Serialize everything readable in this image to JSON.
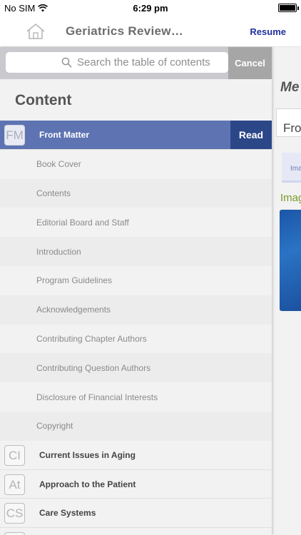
{
  "status_bar": {
    "carrier": "No SIM",
    "time": "6:29 pm"
  },
  "nav": {
    "title": "Geriatrics Review…",
    "resume_label": "Resume"
  },
  "search": {
    "placeholder": "Search the table of contents",
    "value": "",
    "cancel_label": "Cancel"
  },
  "toc": {
    "heading": "Content",
    "front_matter": {
      "badge": "FM",
      "title": "Front Matter",
      "read_label": "Read"
    },
    "front_items": [
      "Book Cover",
      "Contents",
      "Editorial Board and Staff",
      "Introduction",
      "Program Guidelines",
      "Acknowledgements",
      "Contributing Chapter Authors",
      "Contributing Question Authors",
      "Disclosure of Financial Interests",
      "Copyright"
    ],
    "chapters": [
      {
        "badge": "CI",
        "title": "Current Issues in Aging"
      },
      {
        "badge": "At",
        "title": "Approach to the Patient"
      },
      {
        "badge": "CS",
        "title": "Care Systems"
      }
    ]
  },
  "background_pane": {
    "heading": "Me",
    "card_title": "Fro",
    "tab_label": "Ima",
    "section_label": "Imag"
  },
  "colors": {
    "accent": "#1f2fa0",
    "active_row": "#5e74b2",
    "read_button": "#2c4788"
  }
}
